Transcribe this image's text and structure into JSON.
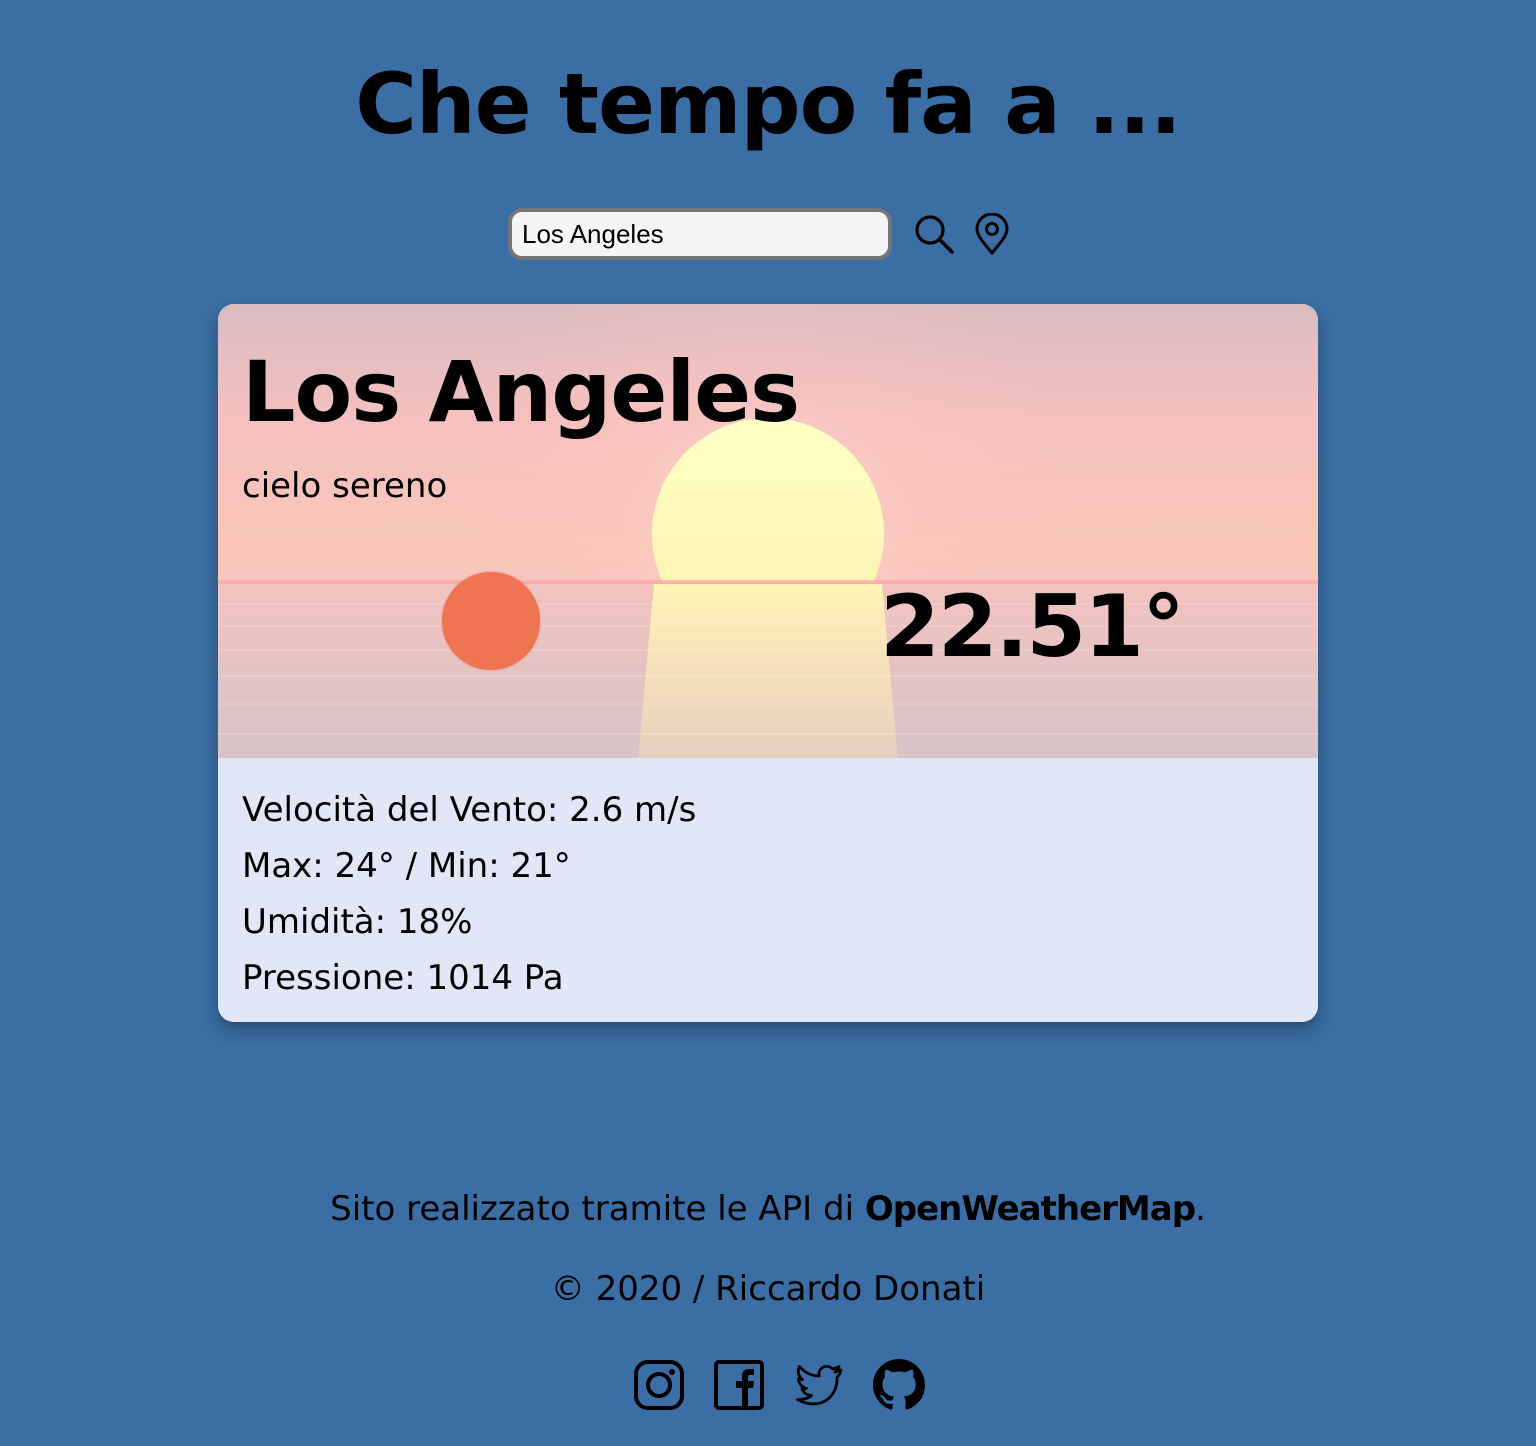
{
  "header": {
    "title": "Che tempo fa a ..."
  },
  "search": {
    "value": "Los Angeles",
    "search_icon": "search-icon",
    "location_icon": "location-pin-icon"
  },
  "weather": {
    "city": "Los Angeles",
    "description": "cielo sereno",
    "icon": "sun-icon",
    "temperature": "22.51°",
    "details": [
      "Velocità del Vento: 2.6 m/s",
      "Max: 24° / Min: 21°",
      "Umidità: 18%",
      "Pressione: 1014 Pa"
    ]
  },
  "footer": {
    "credit_prefix": "Sito realizzato tramite le API di ",
    "credit_link": "OpenWeatherMap",
    "credit_suffix": ".",
    "copyright": "© 2020 / Riccardo Donati",
    "social": [
      "instagram-icon",
      "facebook-icon",
      "twitter-icon",
      "github-icon"
    ]
  },
  "colors": {
    "background": "#3a6ea4",
    "card_details_bg": "#e1e7f6",
    "weather_icon": "#ee7452"
  }
}
